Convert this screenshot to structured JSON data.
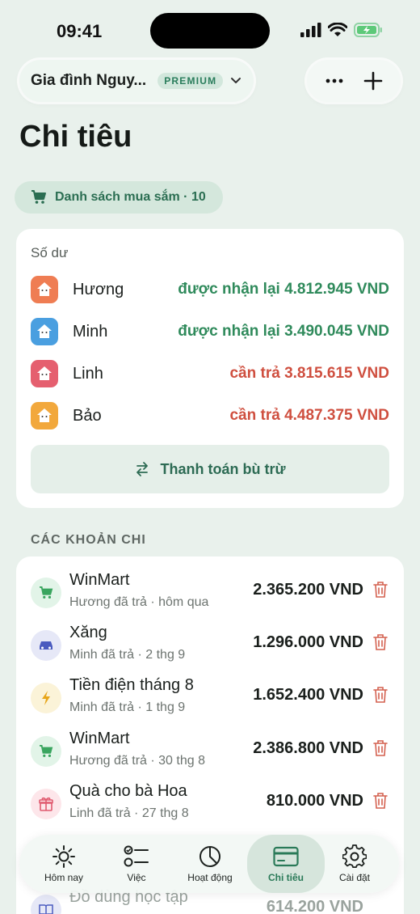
{
  "status_bar": {
    "time": "09:41"
  },
  "header": {
    "family_name": "Gia đình Nguy...",
    "badge": "PREMIUM",
    "page_title": "Chi tiêu"
  },
  "shopping_chip": {
    "label": "Danh sách mua sắm · 10"
  },
  "balance": {
    "label": "Số dư",
    "people": [
      {
        "name": "Hương",
        "amount": "được nhận lại 4.812.945 VND",
        "status": "positive",
        "color": "#ef7d53"
      },
      {
        "name": "Minh",
        "amount": "được nhận lại 3.490.045 VND",
        "status": "positive",
        "color": "#4a9fe0"
      },
      {
        "name": "Linh",
        "amount": "cần trả 3.815.615 VND",
        "status": "negative",
        "color": "#e55f6f"
      },
      {
        "name": "Bảo",
        "amount": "cần trả 4.487.375 VND",
        "status": "negative",
        "color": "#f2a83c"
      }
    ],
    "settle_label": "Thanh toán bù trừ"
  },
  "expenses": {
    "section_title": "CÁC KHOẢN CHI",
    "items": [
      {
        "title": "WinMart",
        "subtitle": "Hương đã trả · hôm qua",
        "amount": "2.365.200 VND",
        "icon": "cart-icon",
        "icon_bg": "#e2f4e8"
      },
      {
        "title": "Xăng",
        "subtitle": "Minh đã trả · 2 thg 9",
        "amount": "1.296.000 VND",
        "icon": "car-icon",
        "icon_bg": "#e6e8f7"
      },
      {
        "title": "Tiền điện tháng 8",
        "subtitle": "Minh đã trả · 1 thg 9",
        "amount": "1.652.400 VND",
        "icon": "lightning-icon",
        "icon_bg": "#fbf3d8"
      },
      {
        "title": "WinMart",
        "subtitle": "Hương đã trả · 30 thg 8",
        "amount": "2.386.800 VND",
        "icon": "cart-icon",
        "icon_bg": "#e2f4e8"
      },
      {
        "title": "Quà cho bà Hoa",
        "subtitle": "Linh đã trả · 27 thg 8",
        "amount": "810.000 VND",
        "icon": "gift-icon",
        "icon_bg": "#fde6ea"
      },
      {
        "title": "Đồ dùng học tập",
        "subtitle": "",
        "amount": "614.200 VND",
        "icon": "book-icon",
        "icon_bg": "#e6e8f7"
      }
    ]
  },
  "bottom_nav": {
    "items": [
      {
        "label": "Hôm nay",
        "icon": "sun-icon",
        "active": false
      },
      {
        "label": "Việc",
        "icon": "checklist-icon",
        "active": false
      },
      {
        "label": "Hoạt động",
        "icon": "pie-chart-icon",
        "active": false
      },
      {
        "label": "Chi tiêu",
        "icon": "card-icon",
        "active": true
      },
      {
        "label": "Cài đặt",
        "icon": "gear-icon",
        "active": false
      }
    ]
  }
}
